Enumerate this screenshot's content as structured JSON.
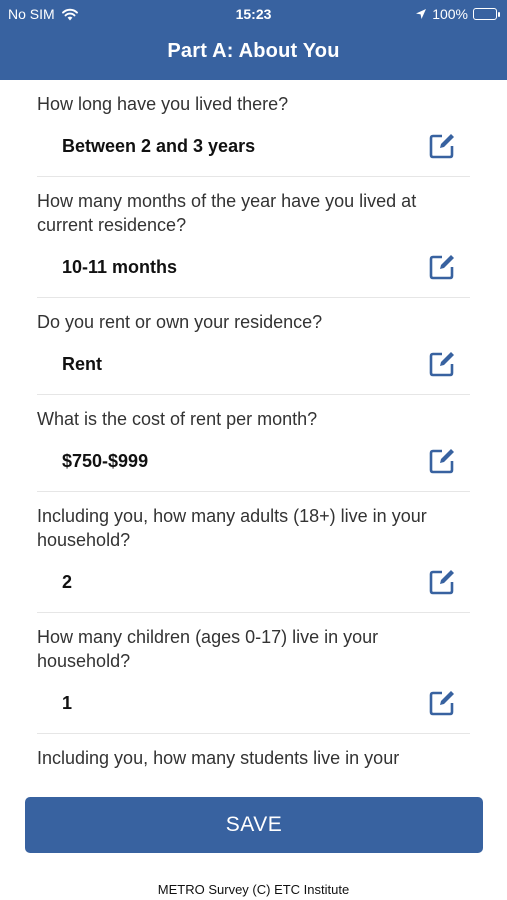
{
  "status_bar": {
    "carrier": "No SIM",
    "time": "15:23",
    "battery": "100%",
    "icons": [
      "wifi-icon",
      "location-arrow-icon",
      "battery-charging-icon"
    ]
  },
  "header": {
    "title": "Part A:  About You"
  },
  "questions": [
    {
      "question": "How long have you lived there?",
      "answer": "Between 2 and 3 years"
    },
    {
      "question": "How many months of the year have you lived at current residence?",
      "answer": "10-11 months"
    },
    {
      "question": "Do you rent or own your residence?",
      "answer": "Rent"
    },
    {
      "question": "What is the cost of rent per month?",
      "answer": "$750-$999"
    },
    {
      "question": "Including you, how many adults (18+) live in your household?",
      "answer": "2"
    },
    {
      "question": "How many children (ages 0-17) live in your household?",
      "answer": "1"
    },
    {
      "question": "Including you, how many students live in your",
      "answer": ""
    }
  ],
  "save_button": {
    "label": "SAVE"
  },
  "footer": {
    "text": "METRO Survey (C) ETC Institute"
  },
  "colors": {
    "brand": "#3862a0",
    "battery": "#4cd964"
  }
}
